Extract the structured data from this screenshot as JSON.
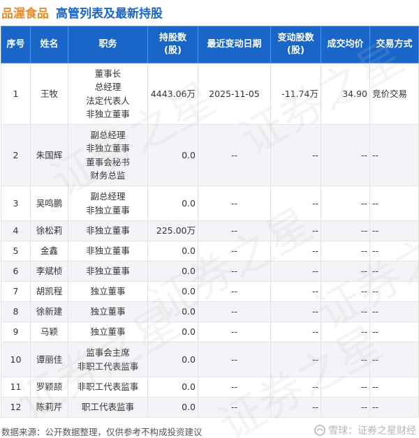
{
  "header": {
    "company": "品渥食品",
    "title": "高管列表及最新持股"
  },
  "table": {
    "columns": [
      "序号",
      "姓名",
      "职务",
      "持股数\n(股)",
      "最近变动日期",
      "变动股数\n(股)",
      "成交均价",
      "交易方式"
    ],
    "rows": [
      {
        "idx": "1",
        "name": "王牧",
        "positions": [
          "董事长",
          "总经理",
          "法定代表人",
          "非独立董事"
        ],
        "holding": "4443.06万",
        "date": "2025-11-05",
        "change": "-11.74万",
        "price": "34.90",
        "type": "竞价交易"
      },
      {
        "idx": "2",
        "name": "朱国辉",
        "positions": [
          "副总经理",
          "非独立董事",
          "董事会秘书",
          "财务总监"
        ],
        "holding": "0.0",
        "date": "--",
        "change": "--",
        "price": "--",
        "type": "--"
      },
      {
        "idx": "3",
        "name": "吴鸣鹏",
        "positions": [
          "副总经理",
          "非独立董事"
        ],
        "holding": "0.0",
        "date": "--",
        "change": "--",
        "price": "--",
        "type": "--"
      },
      {
        "idx": "4",
        "name": "徐松莉",
        "positions": [
          "非独立董事"
        ],
        "holding": "225.00万",
        "date": "--",
        "change": "--",
        "price": "--",
        "type": "--"
      },
      {
        "idx": "5",
        "name": "金鑫",
        "positions": [
          "非独立董事"
        ],
        "holding": "0.0",
        "date": "--",
        "change": "--",
        "price": "--",
        "type": "--"
      },
      {
        "idx": "6",
        "name": "李斌桢",
        "positions": [
          "非独立董事"
        ],
        "holding": "0.0",
        "date": "--",
        "change": "--",
        "price": "--",
        "type": "--"
      },
      {
        "idx": "7",
        "name": "胡凯程",
        "positions": [
          "独立董事"
        ],
        "holding": "0.0",
        "date": "--",
        "change": "--",
        "price": "--",
        "type": "--"
      },
      {
        "idx": "8",
        "name": "徐新建",
        "positions": [
          "独立董事"
        ],
        "holding": "0.0",
        "date": "--",
        "change": "--",
        "price": "--",
        "type": "--"
      },
      {
        "idx": "9",
        "name": "马颖",
        "positions": [
          "独立董事"
        ],
        "holding": "0.0",
        "date": "--",
        "change": "--",
        "price": "--",
        "type": "--"
      },
      {
        "idx": "10",
        "name": "谭丽佳",
        "positions": [
          "监事会主席",
          "非职工代表监事"
        ],
        "holding": "0.0",
        "date": "--",
        "change": "--",
        "price": "--",
        "type": "--"
      },
      {
        "idx": "11",
        "name": "罗颖颉",
        "positions": [
          "非职工代表监事"
        ],
        "holding": "0.0",
        "date": "--",
        "change": "--",
        "price": "--",
        "type": "--"
      },
      {
        "idx": "12",
        "name": "陈莉芹",
        "positions": [
          "职工代表监事"
        ],
        "holding": "0.0",
        "date": "--",
        "change": "--",
        "price": "--",
        "type": "--"
      }
    ]
  },
  "footer": {
    "source": "数据来源：公开数据整理，仅供参考不构成投资建议",
    "brand": "雪球：证券之星财经"
  },
  "watermark_text": "证券之星",
  "colors": {
    "header_bg": "#1a66c8",
    "company": "#e98b2a",
    "title": "#1a66c8",
    "positive": "#2ea12e"
  }
}
